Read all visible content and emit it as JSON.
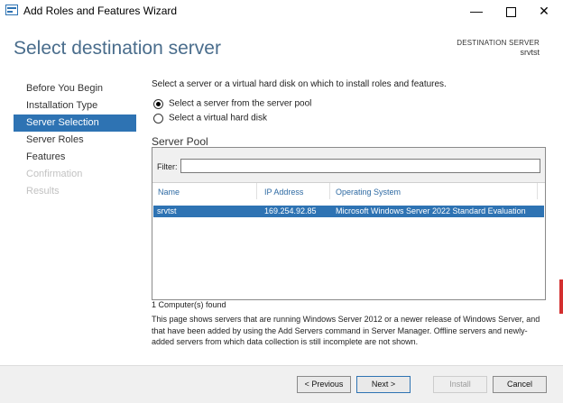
{
  "window": {
    "title": "Add Roles and Features Wizard",
    "controls": {
      "minimize": "—",
      "close": "✕"
    }
  },
  "header": {
    "heading": "Select destination server",
    "destination_label": "DESTINATION SERVER",
    "destination_server": "srvtst"
  },
  "nav": {
    "items": [
      {
        "label": "Before You Begin",
        "state": "normal"
      },
      {
        "label": "Installation Type",
        "state": "normal"
      },
      {
        "label": "Server Selection",
        "state": "active"
      },
      {
        "label": "Server Roles",
        "state": "normal"
      },
      {
        "label": "Features",
        "state": "normal"
      },
      {
        "label": "Confirmation",
        "state": "disabled"
      },
      {
        "label": "Results",
        "state": "disabled"
      }
    ]
  },
  "main": {
    "instruction": "Select a server or a virtual hard disk on which to install roles and features.",
    "options": [
      {
        "label": "Select a server from the server pool",
        "checked": true
      },
      {
        "label": "Select a virtual hard disk",
        "checked": false
      }
    ],
    "pool_title": "Server Pool",
    "filter_label": "Filter:",
    "filter_value": "",
    "columns": [
      "Name",
      "IP Address",
      "Operating System"
    ],
    "rows": [
      {
        "name": "srvtst",
        "ip": "169.254.92.85",
        "os": "Microsoft Windows Server 2022 Standard Evaluation",
        "selected": true
      }
    ],
    "count": "1 Computer(s) found",
    "description": "This page shows servers that are running Windows Server 2012 or a newer release of Windows Server, and that have been added by using the Add Servers command in Server Manager. Offline servers and newly-added servers from which data collection is still incomplete are not shown."
  },
  "footer": {
    "previous": "< Previous",
    "next": "Next >",
    "install": "Install",
    "cancel": "Cancel"
  },
  "colors": {
    "accent": "#2e73b3",
    "heading": "#4a6d8c",
    "edge": "#d32f2f"
  }
}
